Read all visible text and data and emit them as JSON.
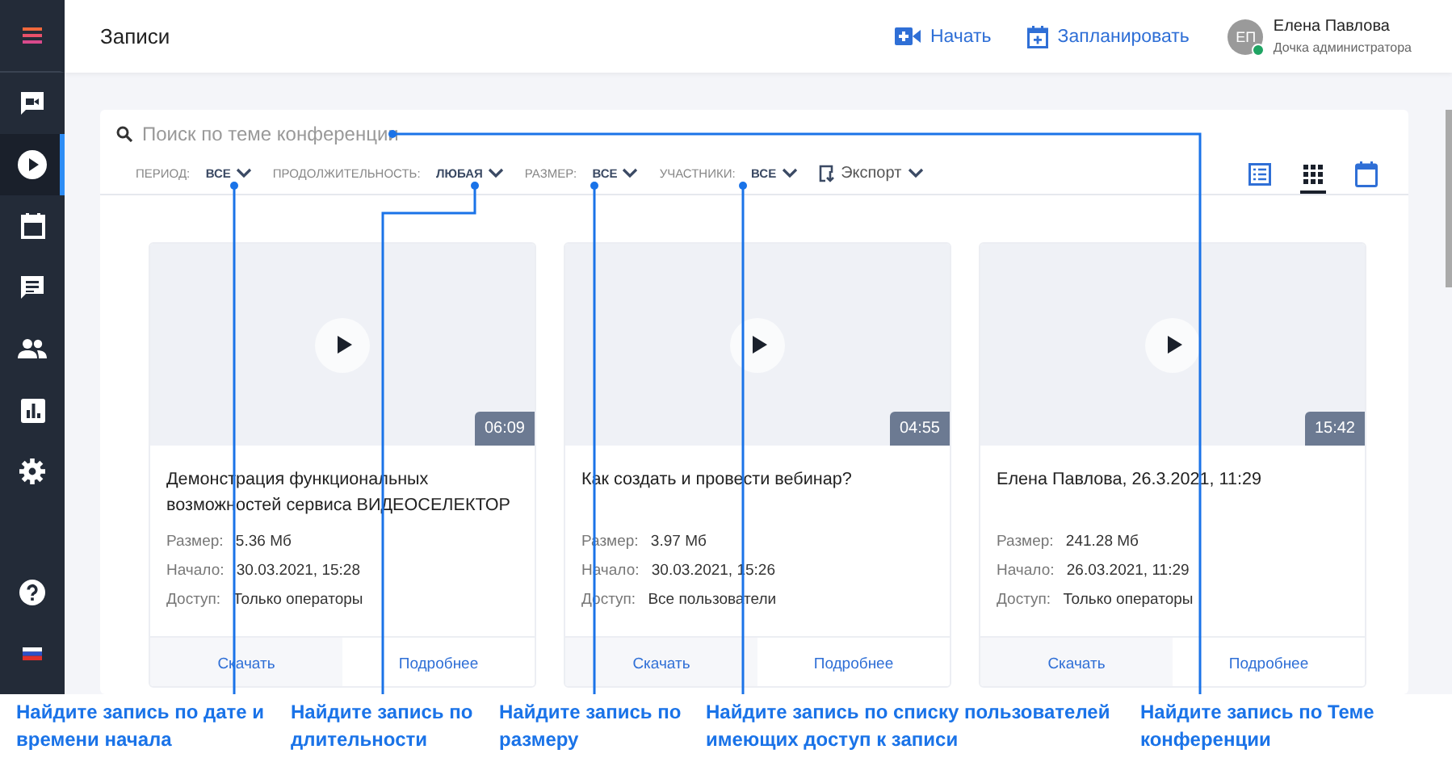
{
  "header": {
    "title": "Записи",
    "actions": [
      {
        "label": "Начать"
      },
      {
        "label": "Запланировать"
      }
    ],
    "user": {
      "initials": "ЕП",
      "name": "Елена Павлова",
      "role": "Дочка администратора",
      "online": true
    }
  },
  "sidebar": {
    "items": [
      {
        "selected": false
      },
      {
        "selected": false
      },
      {
        "selected": true
      },
      {
        "selected": false
      },
      {
        "selected": false
      },
      {
        "selected": false
      },
      {
        "selected": false
      },
      {
        "selected": false
      }
    ],
    "bottom": [
      {
        "selected": false
      },
      {
        "selected": false
      }
    ]
  },
  "search": {
    "placeholder": "Поиск по теме конференции"
  },
  "filters": [
    {
      "label": "ПЕРИОД:",
      "value": "ВСЕ"
    },
    {
      "label": "ПРОДОЛЖИТЕЛЬНОСТЬ:",
      "value": "ЛЮБАЯ"
    },
    {
      "label": "РАЗМЕР:",
      "value": "ВСЕ"
    },
    {
      "label": "УЧАСТНИКИ:",
      "value": "ВСЕ"
    }
  ],
  "export": {
    "label": "Экспорт"
  },
  "views": [
    {
      "selected": false
    },
    {
      "selected": true
    },
    {
      "selected": false
    }
  ],
  "cards": [
    {
      "duration": "06:09",
      "title": "Демонстрация функциональных возможностей сервиса ВИДЕОСЕЛЕКТОР",
      "meta": [
        {
          "label": "Размер:",
          "value": "5.36 Мб"
        },
        {
          "label": "Начало:",
          "value": "30.03.2021, 15:28"
        },
        {
          "label": "Доступ:",
          "value": "Только операторы"
        }
      ],
      "buttons": [
        "Скачать",
        "Подробнее"
      ]
    },
    {
      "duration": "04:55",
      "title": "Как создать и провести вебинар?",
      "meta": [
        {
          "label": "Размер:",
          "value": "3.97 Мб"
        },
        {
          "label": "Начало:",
          "value": "30.03.2021, 15:26"
        },
        {
          "label": "Доступ:",
          "value": "Все пользователи"
        }
      ],
      "buttons": [
        "Скачать",
        "Подробнее"
      ]
    },
    {
      "duration": "15:42",
      "title": "Елена Павлова, 26.3.2021, 11:29",
      "meta": [
        {
          "label": "Размер:",
          "value": "241.28 Мб"
        },
        {
          "label": "Начало:",
          "value": "26.03.2021, 11:29"
        },
        {
          "label": "Доступ:",
          "value": "Только операторы"
        }
      ],
      "buttons": [
        "Скачать",
        "Подробнее"
      ]
    }
  ],
  "callouts": [
    "Найдите запись по дате и времени начала",
    "Найдите запись по длительности",
    "Найдите запись по размеру",
    "Найдите запись по списку пользователей имеющих доступ к записи",
    "Найдите запись по Теме конференции"
  ]
}
